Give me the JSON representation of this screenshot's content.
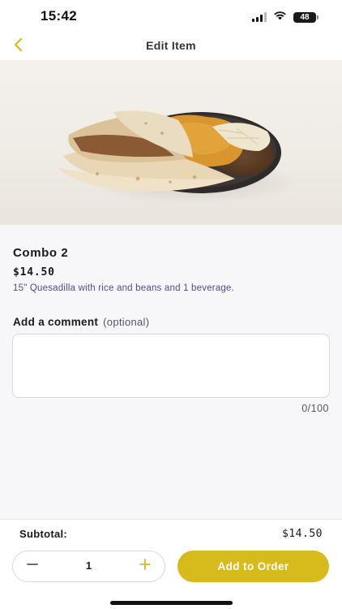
{
  "status_bar": {
    "time": "15:42",
    "battery_level": "48",
    "icons": [
      "cellular-signal-icon",
      "wifi-icon",
      "battery-icon"
    ]
  },
  "nav": {
    "title": "Edit Item",
    "back_icon": "chevron-left-icon"
  },
  "item": {
    "name": "Combo 2",
    "price": "$14.50",
    "description": "15\" Quesadilla with rice and beans and 1 beverage."
  },
  "comment": {
    "label": "Add a comment",
    "optional_hint": "(optional)",
    "value": "",
    "placeholder": "",
    "counter": "0/100"
  },
  "footer": {
    "subtotal_label": "Subtotal:",
    "subtotal_value": "$14.50",
    "quantity": "1",
    "minus_icon": "minus-icon",
    "plus_icon": "plus-icon",
    "add_button_label": "Add to Order"
  },
  "colors": {
    "accent": "#d7ba1c",
    "description_text": "#4e4e8a",
    "border": "#d7d7e6",
    "background": "#f7f7f9"
  }
}
